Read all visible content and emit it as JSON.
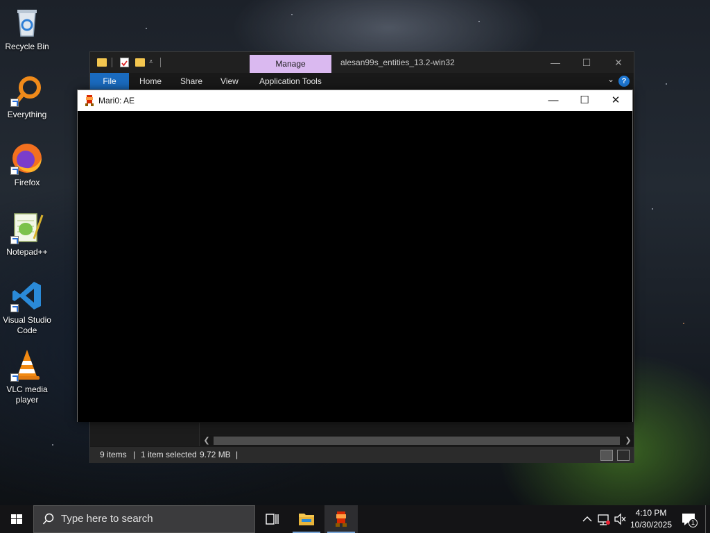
{
  "desktop": {
    "icons": [
      {
        "label": "Recycle Bin"
      },
      {
        "label": "Everything"
      },
      {
        "label": "Firefox"
      },
      {
        "label": "Notepad++"
      },
      {
        "label": "Visual Studio Code"
      },
      {
        "label": "VLC media player"
      }
    ]
  },
  "explorer": {
    "manage_tab": "Manage",
    "title": "alesan99s_entities_13.2-win32",
    "ribbon_tabs": [
      "File",
      "Home",
      "Share",
      "View",
      "Application Tools"
    ],
    "help_glyph": "?",
    "status": {
      "items": "9 items",
      "selected": "1 item selected",
      "size": "9.72 MB"
    }
  },
  "game_window": {
    "title": "Mari0: AE"
  },
  "taskbar": {
    "search_placeholder": "Type here to search",
    "clock_time": "4:10 PM",
    "clock_date": "10/30/2025",
    "notification_count": "1"
  },
  "colors": {
    "manage_tab": "#dab9f0",
    "file_tab": "#1a6bbf",
    "taskbar": "#141416",
    "folder_yellow": "#f4c64f"
  }
}
